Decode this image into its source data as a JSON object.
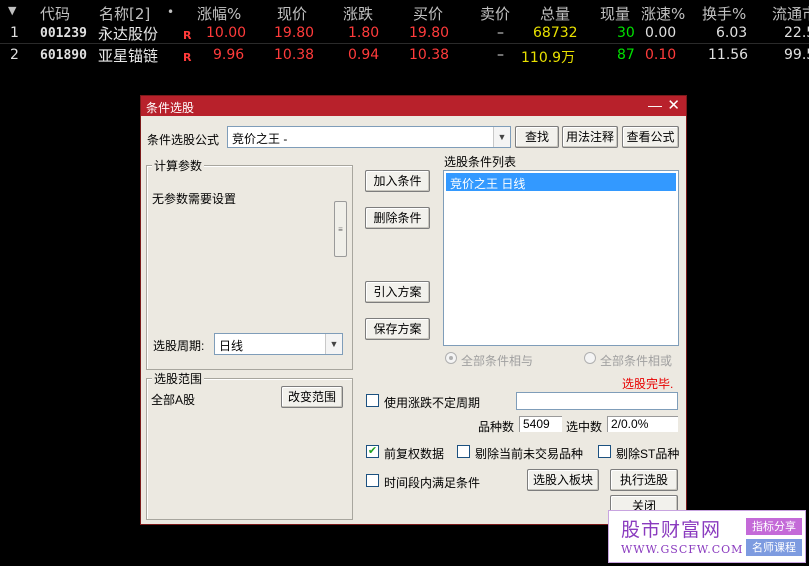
{
  "table": {
    "menu_arrow": "▼",
    "headers": [
      "代码",
      "名称[2]",
      "•",
      "涨幅%",
      "现价",
      "涨跌",
      "买价",
      "卖价",
      "总量",
      "现量",
      "涨速%",
      "换手%",
      "流通市"
    ],
    "rows": [
      {
        "index": "1",
        "code": "001239",
        "name": "永达股份",
        "flag": "R",
        "change_pct": "10.00",
        "price": "19.80",
        "change": "1.80",
        "bid": "19.80",
        "ask": "–",
        "volume": "68732",
        "last_vol": "30",
        "speed": "0.00",
        "turnover": "6.03",
        "float_cap": "22.5"
      },
      {
        "index": "2",
        "code": "601890",
        "name": "亚星锚链",
        "flag": "R",
        "change_pct": "9.96",
        "price": "10.38",
        "change": "0.94",
        "bid": "10.38",
        "ask": "–",
        "volume": "110.9万",
        "last_vol": "87",
        "speed": "0.10",
        "turnover": "11.56",
        "float_cap": "99.5"
      }
    ]
  },
  "dialog": {
    "title": "条件选股",
    "minimize": "—",
    "close": "✕",
    "formula_label": "条件选股公式",
    "formula_value": "竞价之王  -",
    "btn_find": "查找",
    "btn_usage": "用法注释",
    "btn_view": "查看公式",
    "params_title": "计算参数",
    "params_text": "无参数需要设置",
    "period_label": "选股周期:",
    "period_value": "日线",
    "scope_title": "选股范围",
    "scope_value": "全部A股",
    "btn_change_scope": "改变范围",
    "btn_add": "加入条件",
    "btn_delete": "删除条件",
    "btn_import": "引入方案",
    "btn_save": "保存方案",
    "list_title": "选股条件列表",
    "list_items": [
      "竞价之王  日线"
    ],
    "radio_and": "全部条件相与",
    "radio_or": "全部条件相或",
    "status": "选股完毕.",
    "chk_uncertain_period": "使用涨跌不定周期",
    "count_label": "品种数",
    "count_value": "5409",
    "selected_label": "选中数",
    "selected_value": "2/0.0%",
    "chk_adjusted": "前复权数据",
    "chk_exclude_untraded": "剔除当前未交易品种",
    "chk_exclude_st": "剔除ST品种",
    "chk_time_range": "时间段内满足条件",
    "btn_to_block": "选股入板块",
    "btn_execute": "执行选股",
    "btn_close": "关闭"
  },
  "watermark": {
    "title": "股市财富网",
    "url": "WWW.GSCFW.COM",
    "tag1": "指标分享",
    "tag2": "名师课程"
  },
  "colors": {
    "titlebar": "#b8212b",
    "up_red": "#ff3b3b",
    "volume_yellow": "#e8e000",
    "lastvol_green": "#00e000",
    "selection_blue": "#3399ff"
  }
}
